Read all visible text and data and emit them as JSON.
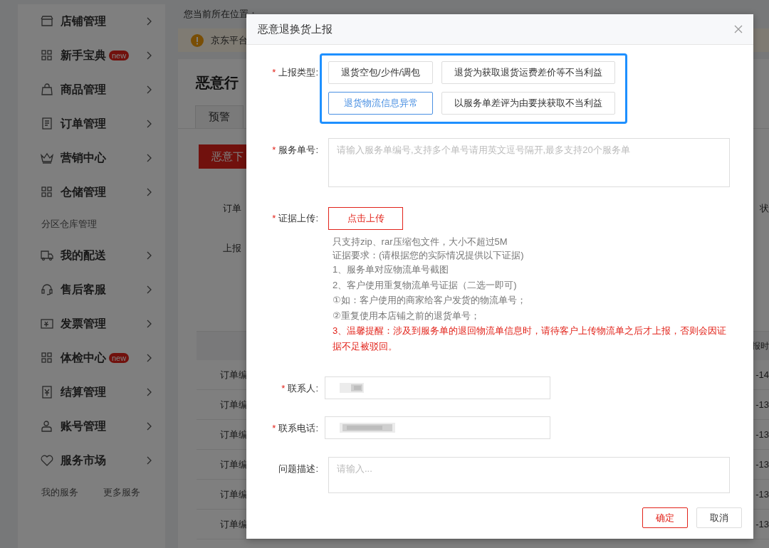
{
  "sidebar": {
    "items": [
      {
        "label": "店铺管理"
      },
      {
        "label": "新手宝典",
        "badge": "new"
      },
      {
        "label": "商品管理"
      },
      {
        "label": "订单管理"
      },
      {
        "label": "营销中心"
      },
      {
        "label": "仓储管理",
        "children": [
          {
            "label": "分区仓库管理"
          }
        ]
      },
      {
        "label": "我的配送"
      },
      {
        "label": "售后客服"
      },
      {
        "label": "发票管理"
      },
      {
        "label": "体检中心",
        "badge": "new"
      },
      {
        "label": "结算管理"
      },
      {
        "label": "账号管理"
      },
      {
        "label": "服务市场",
        "children": [
          {
            "label": "我的服务"
          },
          {
            "label": "更多服务"
          }
        ]
      }
    ]
  },
  "page": {
    "breadcrumb_label": "您当前所在位置：",
    "notice": "京东平台",
    "heading": "恶意行",
    "tabs": [
      {
        "label": "预警",
        "selected": false
      }
    ],
    "action_button": "恶意下",
    "filters": [
      {
        "label": "订单"
      },
      {
        "label": "上报"
      }
    ],
    "filter_right": "状",
    "table": {
      "header_right": "报时",
      "rows": [
        {
          "column_1": "订单编",
          "column_2": "-14"
        },
        {
          "column_1": "订单编",
          "column_2": "-13"
        },
        {
          "column_1": "订单编",
          "column_2": "-13"
        },
        {
          "column_1": "订单编",
          "column_2": "-13"
        },
        {
          "column_1": "订单编",
          "column_2": "-13"
        },
        {
          "column_1": "订单编",
          "column_2": "-13"
        }
      ]
    }
  },
  "dialog": {
    "title": "恶意退换货上报",
    "fields": [
      {
        "kind": "options",
        "label": "上报类型:",
        "required_mark": "*",
        "highlighted": true,
        "options": [
          {
            "label": "退货空包/少件/调包",
            "selected": false
          },
          {
            "label": "退货为获取退货运费差价等不当利益",
            "selected": false
          },
          {
            "label": "退货物流信息异常",
            "selected": true
          },
          {
            "label": "以服务单差评为由要挟获取不当利益",
            "selected": false
          }
        ]
      },
      {
        "kind": "textarea",
        "label": "服务单号:",
        "required_mark": "*",
        "placeholder": "请输入服务单编号,支持多个单号请用英文逗号隔开,最多支持20个服务单"
      },
      {
        "kind": "upload",
        "label": "证据上传:",
        "required_mark": "*",
        "button": "点击上传",
        "notes": [
          {
            "text": "只支持zip、rar压缩包文件，大小不超过5M",
            "warning": false
          },
          {
            "text": "证据要求：(请根据您的实际情况提供以下证据)",
            "warning": false
          },
          {
            "text": "1、服务单对应物流单号截图",
            "warning": false
          },
          {
            "text": "2、客户使用重复物流单号证据（二选一即可)",
            "warning": false
          },
          {
            "text": "①如：客户使用的商家给客户发货的物流单号；",
            "warning": false
          },
          {
            "text": "②重复使用本店铺之前的退货单号；",
            "warning": false
          },
          {
            "text": "3、温馨提醒：涉及到服务单的退回物流单信息时，请待客户上传物流单之后才上报，否则会因证据不足被驳回。",
            "warning": true
          }
        ]
      },
      {
        "kind": "text",
        "label": "联系人:",
        "required_mark": "*",
        "redacted": true
      },
      {
        "kind": "text",
        "label": "联系电话:",
        "required_mark": "*",
        "redacted": true
      },
      {
        "kind": "textarea",
        "label": "问题描述:",
        "placeholder": "请输入..."
      }
    ],
    "buttons": [
      {
        "label": "确定",
        "kind": "primary"
      },
      {
        "label": "取消",
        "kind": "default"
      }
    ]
  }
}
